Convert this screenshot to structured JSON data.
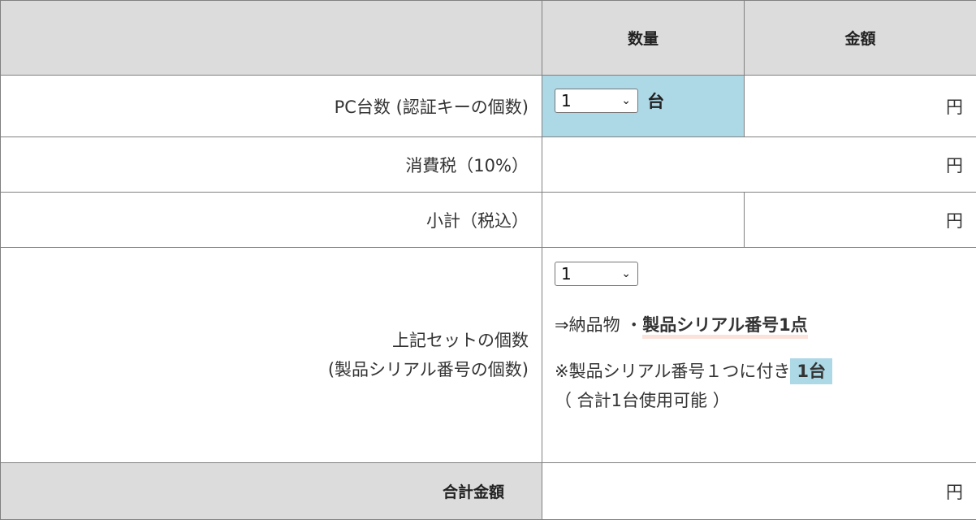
{
  "header": {
    "qty": "数量",
    "amount": "金額"
  },
  "rows": {
    "pc": {
      "label": "PC台数 (認証キーの個数)",
      "select_value": "1",
      "unit": "台",
      "yen": "円"
    },
    "tax": {
      "label": "消費税（10%）",
      "yen": "円"
    },
    "subtotal": {
      "label": "小計（税込）",
      "yen": "円"
    },
    "set": {
      "label_line1": "上記セットの個数",
      "label_line2": "(製品シリアル番号の個数)",
      "select_value": "1",
      "delivery_prefix": "⇒納品物 ・",
      "delivery_item": "製品シリアル番号1点",
      "note_prefix": "※製品シリアル番号１つに付き",
      "note_highlight": "1台",
      "note_total": "（ 合計1台使用可能 ）"
    },
    "total": {
      "label": "合計金額",
      "yen": "円"
    }
  },
  "colors": {
    "header_bg": "#dcdcdc",
    "highlight_blue": "#add8e6",
    "underline_pink": "#fbe3dc"
  },
  "icons": {
    "select_chevron": "chevron-down-icon"
  }
}
